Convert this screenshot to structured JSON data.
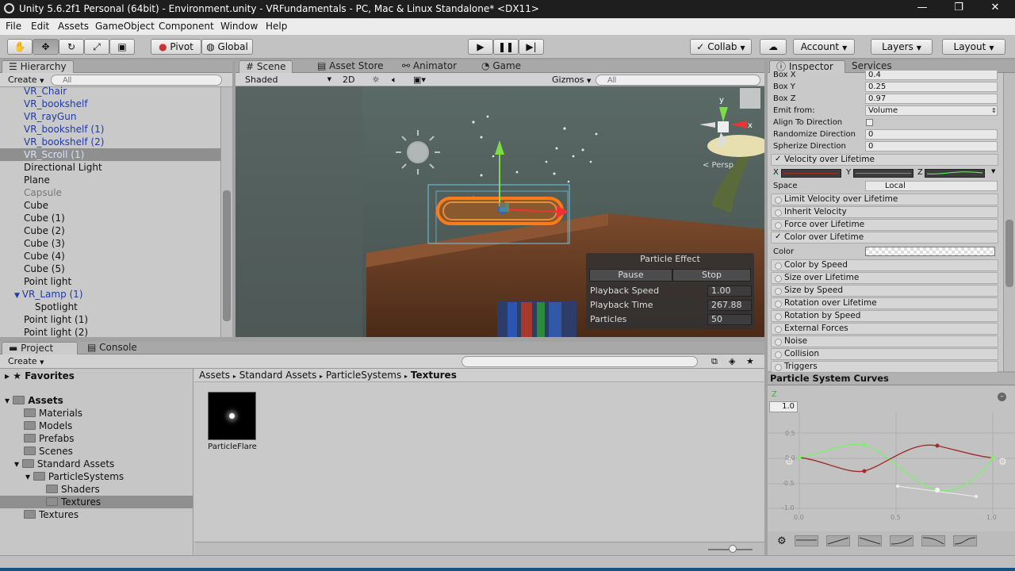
{
  "window": {
    "title": "Unity 5.6.2f1 Personal (64bit) - Environment.unity - VRFundamentals - PC, Mac & Linux Standalone* <DX11>"
  },
  "menu": [
    "File",
    "Edit",
    "Assets",
    "GameObject",
    "Component",
    "Window",
    "Help"
  ],
  "toolbar": {
    "pivot": "Pivot",
    "global": "Global",
    "collab": "Collab",
    "account": "Account",
    "layers": "Layers",
    "layout": "Layout"
  },
  "hierarchy": {
    "tab": "Hierarchy",
    "create": "Create",
    "search_placeholder": "All",
    "items": [
      {
        "label": "VR_Chair",
        "style": "blue"
      },
      {
        "label": "VR_bookshelf",
        "style": "blue"
      },
      {
        "label": "VR_rayGun",
        "style": "blue"
      },
      {
        "label": "VR_bookshelf (1)",
        "style": "blue"
      },
      {
        "label": "VR_bookshelf (2)",
        "style": "blue"
      },
      {
        "label": "VR_Scroll (1)",
        "style": "selected"
      },
      {
        "label": "Directional Light",
        "style": "normal"
      },
      {
        "label": "Plane",
        "style": "normal"
      },
      {
        "label": "Capsule",
        "style": "gray"
      },
      {
        "label": "Cube",
        "style": "normal"
      },
      {
        "label": "Cube (1)",
        "style": "normal"
      },
      {
        "label": "Cube (2)",
        "style": "normal"
      },
      {
        "label": "Cube (3)",
        "style": "normal"
      },
      {
        "label": "Cube (4)",
        "style": "normal"
      },
      {
        "label": "Cube (5)",
        "style": "normal"
      },
      {
        "label": "Point light",
        "style": "normal"
      },
      {
        "label": "VR_Lamp (1)",
        "style": "blue-expanded"
      },
      {
        "label": "Spotlight",
        "style": "child"
      },
      {
        "label": "Point light (1)",
        "style": "normal"
      },
      {
        "label": "Point light (2)",
        "style": "normal"
      }
    ]
  },
  "scene": {
    "tabs": [
      "Scene",
      "Asset Store",
      "Animator",
      "Game"
    ],
    "shading": "Shaded",
    "mode2d": "2D",
    "gizmos": "Gizmos",
    "search_placeholder": "All",
    "persp": "< Persp",
    "particle_effect": {
      "title": "Particle Effect",
      "pause": "Pause",
      "stop": "Stop",
      "rows": [
        {
          "label": "Playback Speed",
          "value": "1.00"
        },
        {
          "label": "Playback Time",
          "value": "267.88"
        },
        {
          "label": "Particles",
          "value": "50"
        }
      ]
    }
  },
  "project": {
    "tabs": [
      "Project",
      "Console"
    ],
    "create": "Create",
    "favorites": "Favorites",
    "assets": "Assets",
    "tree": [
      "Materials",
      "Models",
      "Prefabs",
      "Scenes",
      "Standard Assets",
      "ParticleSystems",
      "Shaders",
      "Textures",
      "Textures"
    ],
    "breadcrumb": [
      "Assets",
      "Standard Assets",
      "ParticleSystems",
      "Textures"
    ],
    "asset_label": "ParticleFlare"
  },
  "inspector": {
    "tabs": [
      "Inspector",
      "Services"
    ],
    "props": [
      {
        "label": "Box X",
        "value": "0.4"
      },
      {
        "label": "Box Y",
        "value": "0.25"
      },
      {
        "label": "Box Z",
        "value": "0.97"
      },
      {
        "label": "Emit from:",
        "value": "Volume"
      },
      {
        "label": "Align To Direction",
        "value": ""
      },
      {
        "label": "Randomize Direction",
        "value": "0"
      },
      {
        "label": "Spherize Direction",
        "value": "0"
      }
    ],
    "velocity_module": "Velocity over Lifetime",
    "xyz": [
      "X",
      "Y",
      "Z"
    ],
    "space_label": "Space",
    "space_value": "Local",
    "modules_a": [
      {
        "label": "Limit Velocity over Lifetime",
        "checked": false
      },
      {
        "label": "Inherit Velocity",
        "checked": false
      },
      {
        "label": "Force over Lifetime",
        "checked": false
      },
      {
        "label": "Color over Lifetime",
        "checked": true
      }
    ],
    "color_label": "Color",
    "modules_b": [
      "Color by Speed",
      "Size over Lifetime",
      "Size by Speed",
      "Rotation over Lifetime",
      "Rotation by Speed",
      "External Forces",
      "Noise",
      "Collision",
      "Triggers"
    ]
  },
  "curves": {
    "title": "Particle System Curves",
    "axis_label": "Z",
    "top_value": "1.0",
    "y_ticks": [
      "0.5",
      "0.0",
      "-0.5",
      "-1.0"
    ],
    "x_ticks": [
      "0.0",
      "0.5",
      "1.0"
    ]
  },
  "colors": {
    "accent": "#3b79c4",
    "curve_red": "#a02c2c",
    "curve_green": "#7cf06c",
    "particle_orange": "#ff7a18"
  }
}
